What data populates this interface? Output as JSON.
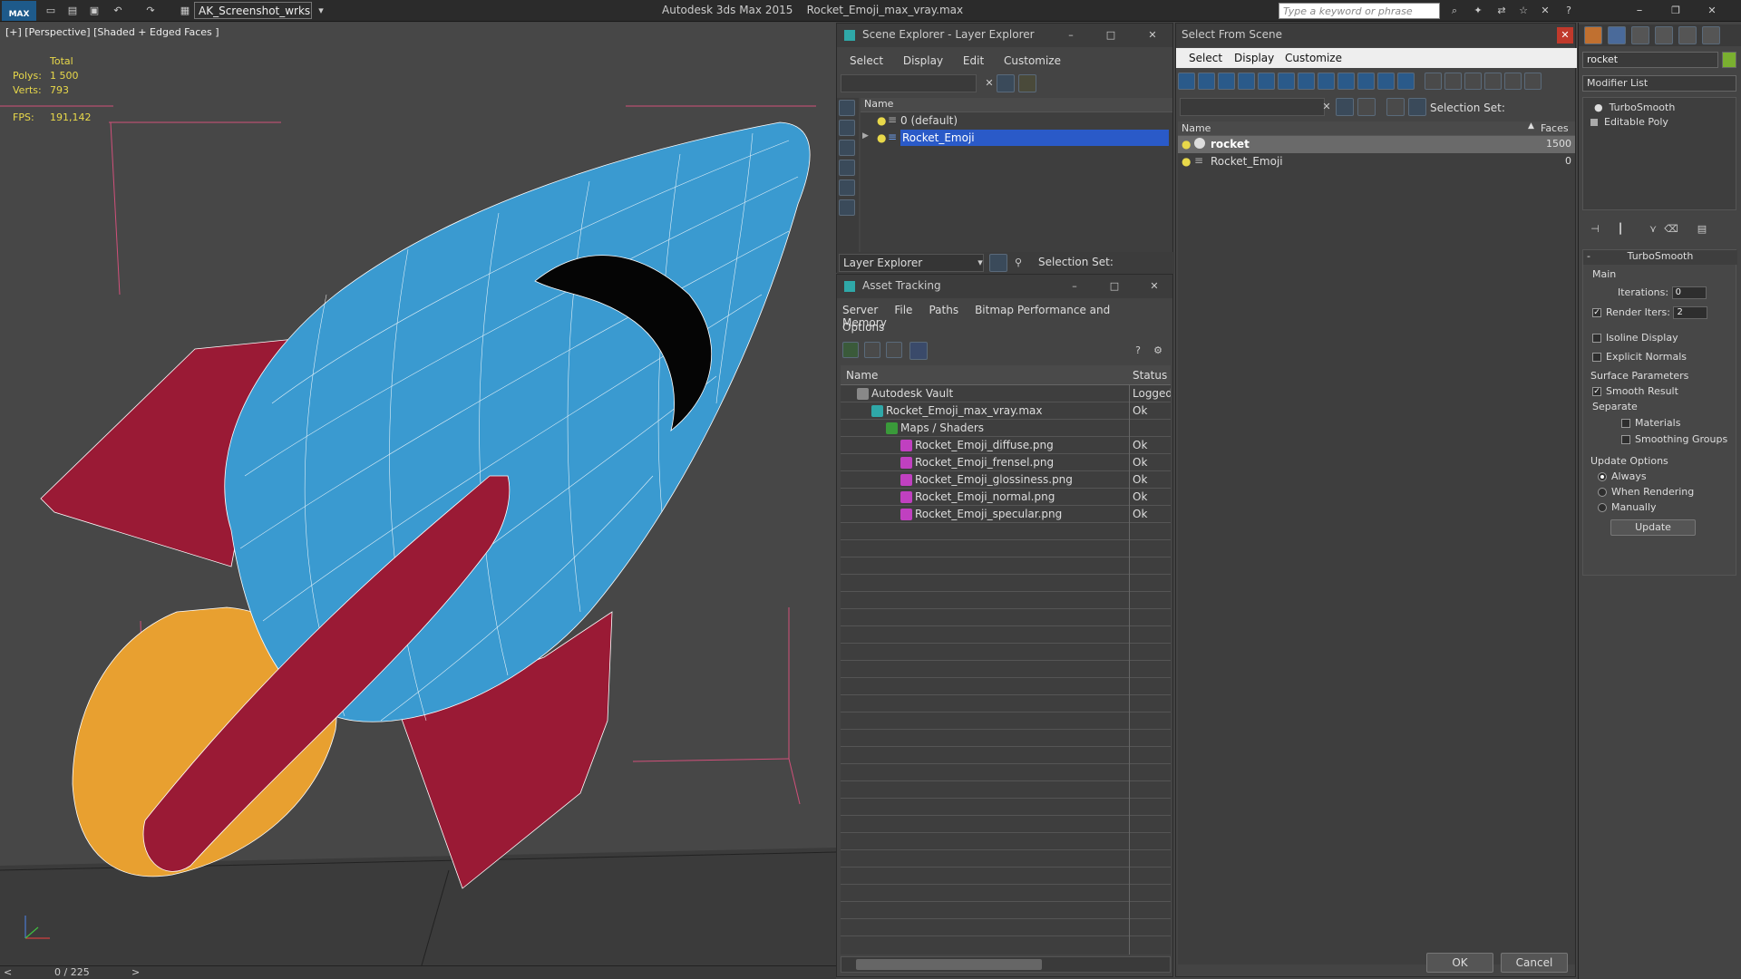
{
  "app": {
    "title": "Autodesk 3ds Max  2015",
    "file": "Rocket_Emoji_max_vray.max",
    "workspace": "AK_Screenshot_wrksp",
    "search_placeholder": "Type a keyword or phrase",
    "logo": "MAX"
  },
  "viewport": {
    "label": "[+] [Perspective] [Shaded + Edged Faces ]",
    "stats": {
      "total_label": "Total",
      "polys_label": "Polys:",
      "polys": "1 500",
      "verts_label": "Verts:",
      "verts": "793",
      "fps_label": "FPS:",
      "fps": "191,142"
    }
  },
  "timeline": {
    "position": "0 / 225",
    "prev": "<",
    "next": ">"
  },
  "scene_explorer": {
    "title": "Scene Explorer - Layer Explorer",
    "menu": [
      "Select",
      "Display",
      "Edit",
      "Customize"
    ],
    "col_name": "Name",
    "layers": [
      {
        "name": "0 (default)",
        "selected": false
      },
      {
        "name": "Rocket_Emoji",
        "selected": true
      }
    ],
    "footer_label": "Layer Explorer",
    "selection_set_label": "Selection Set:"
  },
  "asset_tracking": {
    "title": "Asset Tracking",
    "menu": [
      "Server",
      "File",
      "Paths",
      "Bitmap Performance and Memory"
    ],
    "menu2": "Options",
    "col_name": "Name",
    "col_status": "Status",
    "rows": [
      {
        "name": "Autodesk Vault",
        "status": "Logged",
        "indent": 0,
        "icon": "vault-icon"
      },
      {
        "name": "Rocket_Emoji_max_vray.max",
        "status": "Ok",
        "indent": 1,
        "icon": "max-file-icon"
      },
      {
        "name": "Maps / Shaders",
        "status": "",
        "indent": 2,
        "icon": "maps-icon"
      },
      {
        "name": "Rocket_Emoji_diffuse.png",
        "status": "Ok",
        "indent": 3,
        "icon": "png-icon"
      },
      {
        "name": "Rocket_Emoji_frensel.png",
        "status": "Ok",
        "indent": 3,
        "icon": "png-icon"
      },
      {
        "name": "Rocket_Emoji_glossiness.png",
        "status": "Ok",
        "indent": 3,
        "icon": "png-icon"
      },
      {
        "name": "Rocket_Emoji_normal.png",
        "status": "Ok",
        "indent": 3,
        "icon": "png-icon"
      },
      {
        "name": "Rocket_Emoji_specular.png",
        "status": "Ok",
        "indent": 3,
        "icon": "png-icon"
      }
    ]
  },
  "select_from_scene": {
    "title": "Select From Scene",
    "menu": [
      "Select",
      "Display",
      "Customize"
    ],
    "selection_set_label": "Selection Set:",
    "col_name": "Name",
    "col_faces": "Faces",
    "rows": [
      {
        "name": "rocket",
        "faces": "1500",
        "selected": true
      },
      {
        "name": "Rocket_Emoji",
        "faces": "0",
        "selected": false
      }
    ],
    "ok": "OK",
    "cancel": "Cancel"
  },
  "command_panel": {
    "object_name": "rocket",
    "modifier_list": "Modifier List",
    "stack": [
      "TurboSmooth",
      "Editable Poly"
    ],
    "rollout_title": "TurboSmooth",
    "main_label": "Main",
    "iterations_label": "Iterations:",
    "iterations": "0",
    "render_iters_label": "Render Iters:",
    "render_iters": "2",
    "isoline": "Isoline Display",
    "explicit_normals": "Explicit Normals",
    "surface_params": "Surface Parameters",
    "smooth_result": "Smooth Result",
    "separate": "Separate",
    "materials": "Materials",
    "smoothing_groups": "Smoothing Groups",
    "update_options": "Update Options",
    "always": "Always",
    "when_rendering": "When Rendering",
    "manually": "Manually",
    "update_button": "Update"
  },
  "colors": {
    "rocket_body": "#3a9ad0",
    "fins": "#9a1a35",
    "flame": "#e8a030",
    "selection": "#2a5ac8"
  }
}
